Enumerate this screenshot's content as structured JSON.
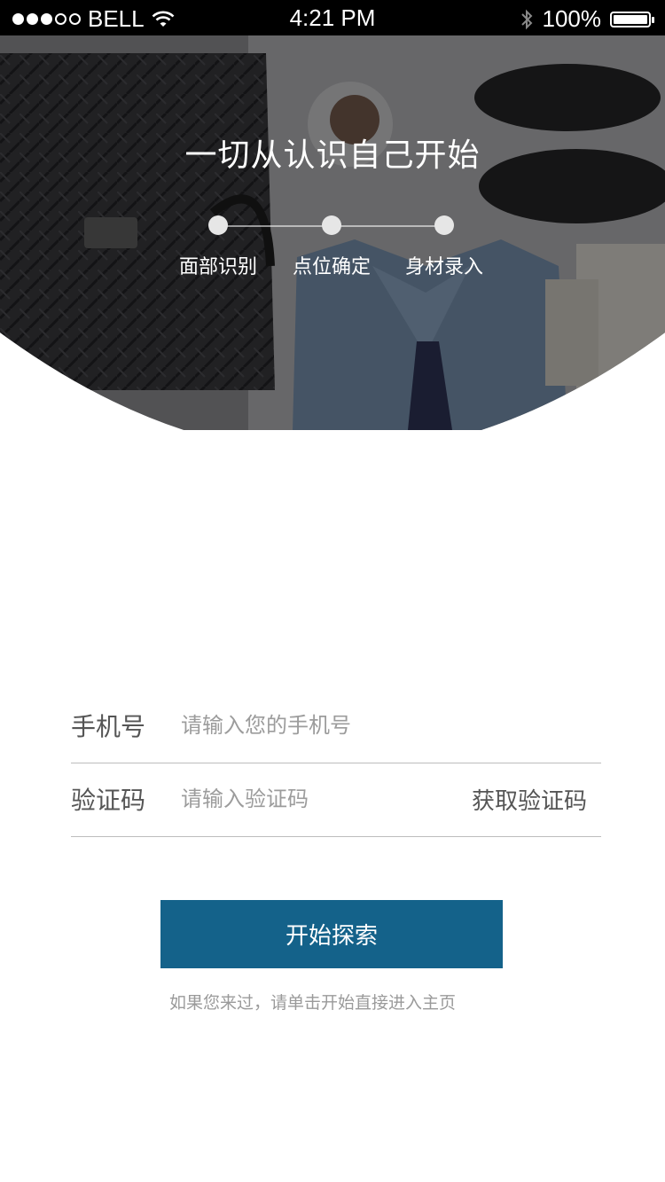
{
  "status_bar": {
    "carrier": "BELL",
    "time": "4:21 PM",
    "battery": "100%",
    "battery_level": 1.0
  },
  "hero": {
    "title": "一切从认识自己开始",
    "steps": [
      "面部识别",
      "点位确定",
      "身材录入"
    ]
  },
  "form": {
    "phone": {
      "label": "手机号",
      "placeholder": "请输入您的手机号",
      "value": ""
    },
    "code": {
      "label": "验证码",
      "placeholder": "请输入验证码",
      "value": "",
      "get_code_label": "获取验证码"
    }
  },
  "primary_button": {
    "label": "开始探索",
    "color": "#14628a"
  },
  "hint": "如果您来过，请单击开始直接进入主页"
}
